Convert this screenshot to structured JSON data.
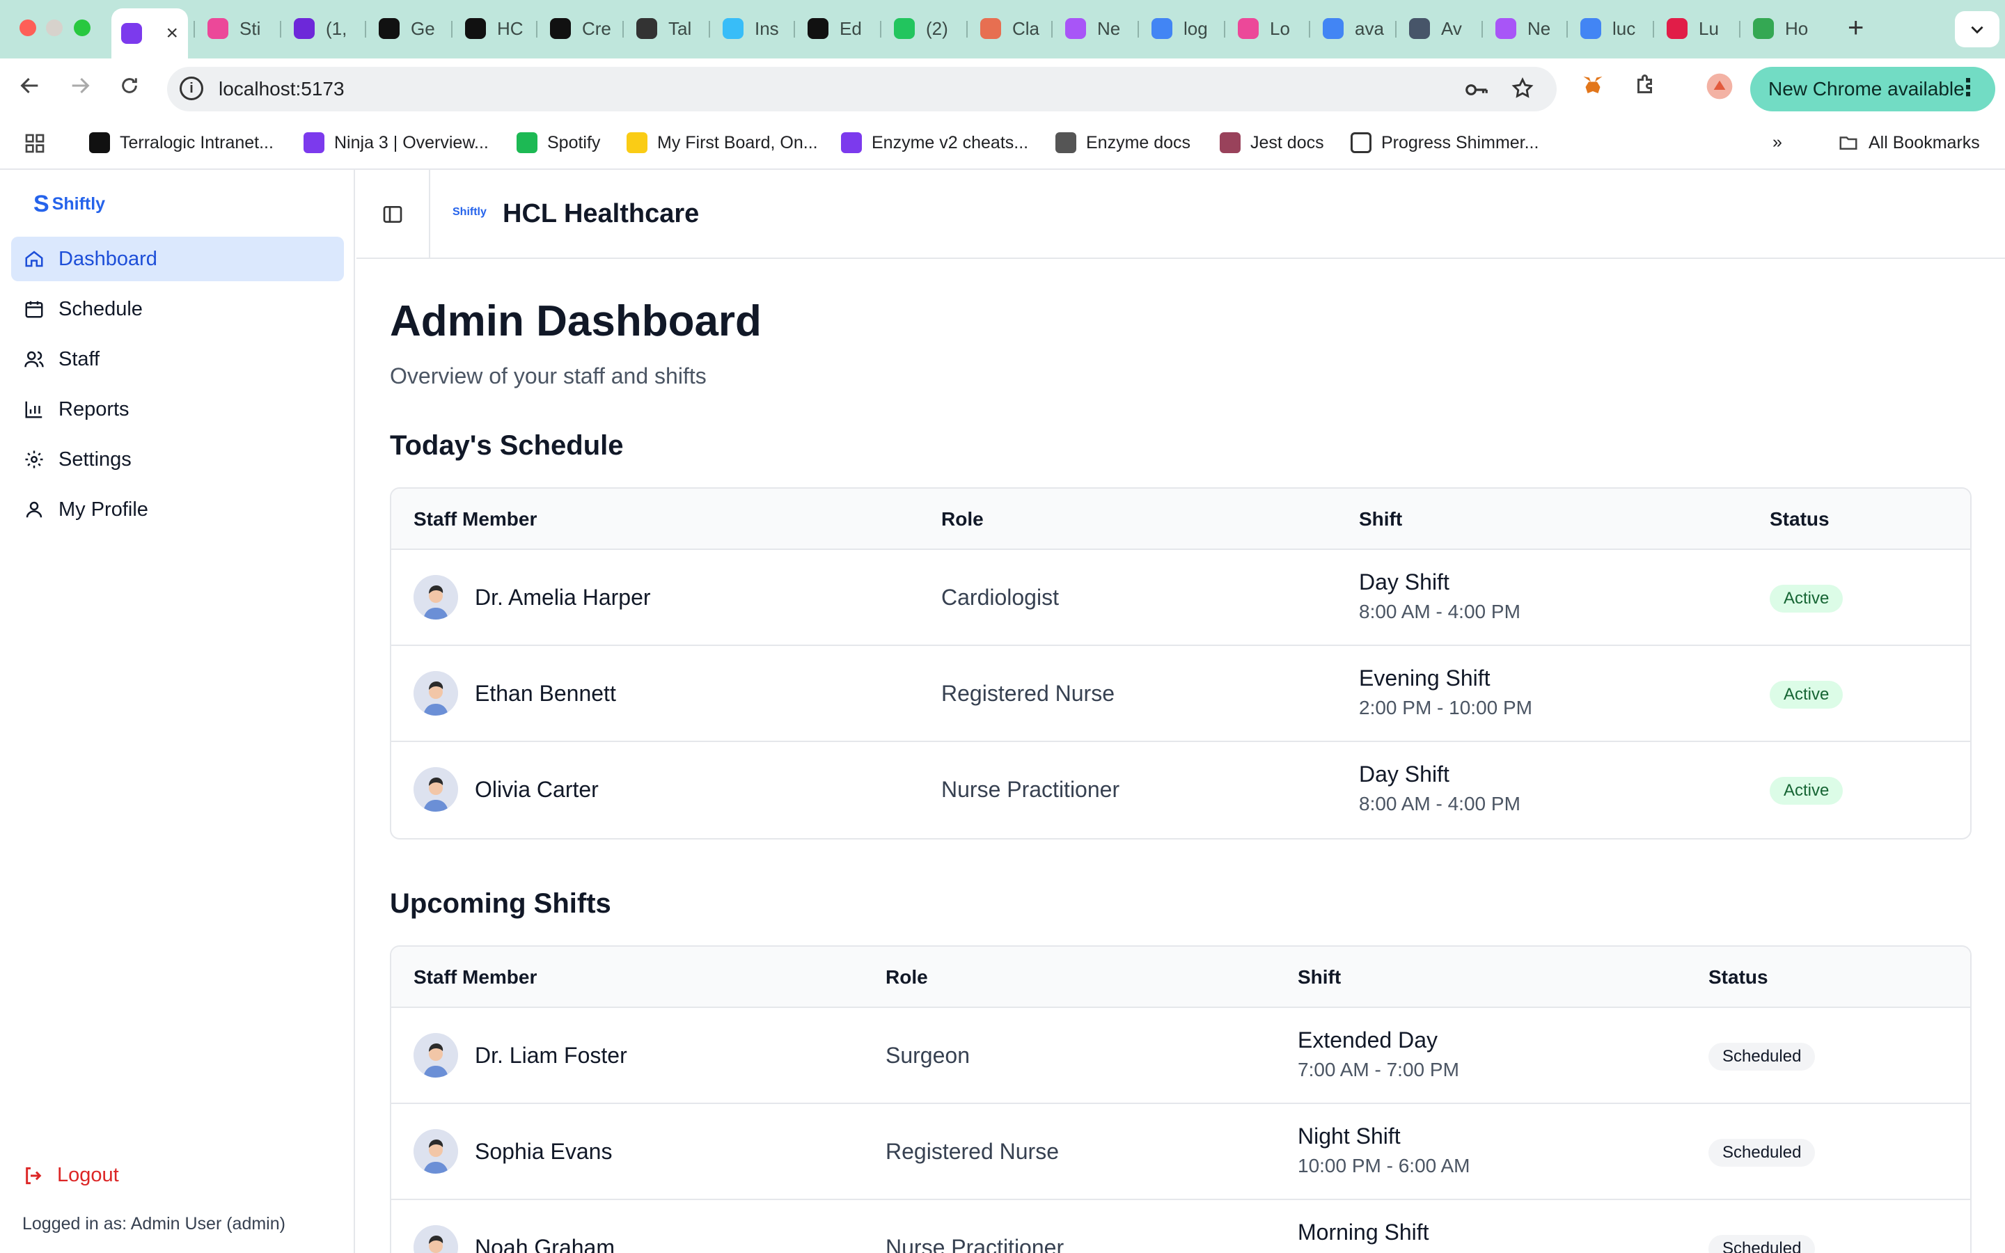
{
  "browser": {
    "tabs": [
      {
        "label": "",
        "fav_color": "#7c3aed",
        "icon": "vite-icon",
        "active": true
      },
      {
        "label": "Sti",
        "fav_color": "#ec4899",
        "icon": "flask-icon"
      },
      {
        "label": "(1,",
        "fav_color": "#6d28d9",
        "icon": "mail-icon"
      },
      {
        "label": "Ge",
        "fav_color": "#111111",
        "icon": "notion-icon"
      },
      {
        "label": "HC",
        "fav_color": "#111111",
        "icon": "openai-icon"
      },
      {
        "label": "Cre",
        "fav_color": "#111111",
        "icon": "triangle-icon"
      },
      {
        "label": "Tal",
        "fav_color": "#333333",
        "icon": "pen-icon"
      },
      {
        "label": "Ins",
        "fav_color": "#38bdf8",
        "icon": "wave-icon"
      },
      {
        "label": "Ed",
        "fav_color": "#111111",
        "icon": "github-icon"
      },
      {
        "label": "(2)",
        "fav_color": "#22c55e",
        "icon": "whatsapp-icon"
      },
      {
        "label": "Cla",
        "fav_color": "#e76f51",
        "icon": "claude-icon"
      },
      {
        "label": "Ne",
        "fav_color": "#a855f7",
        "icon": "heart-icon"
      },
      {
        "label": "log",
        "fav_color": "#4285f4",
        "icon": "google-icon"
      },
      {
        "label": "Lo",
        "fav_color": "#ec4899",
        "icon": "dribbble-icon"
      },
      {
        "label": "ava",
        "fav_color": "#4285f4",
        "icon": "google-icon"
      },
      {
        "label": "Av",
        "fav_color": "#475569",
        "icon": "person-icon"
      },
      {
        "label": "Ne",
        "fav_color": "#a855f7",
        "icon": "heart-icon"
      },
      {
        "label": "luc",
        "fav_color": "#4285f4",
        "icon": "google-icon"
      },
      {
        "label": "Lu",
        "fav_color": "#e11d48",
        "icon": "spiral-icon"
      },
      {
        "label": "Ho",
        "fav_color": "#34a853",
        "icon": "drive-icon"
      }
    ],
    "new_tab_label": "+",
    "url": "localhost:5173",
    "update_label": "New Chrome available",
    "bookmarks": [
      {
        "label": "Terralogic Intranet...",
        "fav_color": "#111111",
        "icon": "globe-icon"
      },
      {
        "label": "Ninja 3 | Overview...",
        "fav_color": "#7c3aed",
        "icon": "ninja-icon"
      },
      {
        "label": "Spotify",
        "fav_color": "#1db954",
        "icon": "spotify-icon"
      },
      {
        "label": "My First Board, On...",
        "fav_color": "#facc15",
        "icon": "miro-icon"
      },
      {
        "label": "Enzyme v2 cheats...",
        "fav_color": "#7c3aed",
        "icon": "doc-icon"
      },
      {
        "label": "Enzyme docs",
        "fav_color": "#555555",
        "icon": "book-icon"
      },
      {
        "label": "Jest docs",
        "fav_color": "#99425b",
        "icon": "jest-icon"
      },
      {
        "label": "Progress Shimmer...",
        "fav_color": "#ffffff",
        "icon": "square-icon"
      }
    ],
    "all_bookmarks_label": "All Bookmarks"
  },
  "sidebar": {
    "brand": "Shiftly",
    "items": [
      {
        "label": "Dashboard",
        "icon": "home-icon",
        "active": true
      },
      {
        "label": "Schedule",
        "icon": "calendar-icon"
      },
      {
        "label": "Staff",
        "icon": "users-icon"
      },
      {
        "label": "Reports",
        "icon": "chart-icon"
      },
      {
        "label": "Settings",
        "icon": "gear-icon"
      },
      {
        "label": "My Profile",
        "icon": "user-icon"
      }
    ],
    "logout_label": "Logout",
    "logged_in_text": "Logged in as: Admin User (admin)"
  },
  "header": {
    "org_logo_text": "Shiftly",
    "org_name": "HCL Healthcare"
  },
  "main": {
    "title": "Admin Dashboard",
    "subtitle": "Overview of your staff and shifts",
    "today": {
      "title": "Today's Schedule",
      "columns": [
        "Staff Member",
        "Role",
        "Shift",
        "Status"
      ],
      "rows": [
        {
          "name": "Dr. Amelia Harper",
          "role": "Cardiologist",
          "shift": "Day Shift",
          "time": "8:00 AM - 4:00 PM",
          "status": "Active"
        },
        {
          "name": "Ethan Bennett",
          "role": "Registered Nurse",
          "shift": "Evening Shift",
          "time": "2:00 PM - 10:00 PM",
          "status": "Active"
        },
        {
          "name": "Olivia Carter",
          "role": "Nurse Practitioner",
          "shift": "Day Shift",
          "time": "8:00 AM - 4:00 PM",
          "status": "Active"
        }
      ]
    },
    "upcoming": {
      "title": "Upcoming Shifts",
      "columns": [
        "Staff Member",
        "Role",
        "Shift",
        "Status"
      ],
      "rows": [
        {
          "name": "Dr. Liam Foster",
          "role": "Surgeon",
          "shift": "Extended Day",
          "time": "7:00 AM - 7:00 PM",
          "status": "Scheduled"
        },
        {
          "name": "Sophia Evans",
          "role": "Registered Nurse",
          "shift": "Night Shift",
          "time": "10:00 PM - 6:00 AM",
          "status": "Scheduled"
        },
        {
          "name": "Noah Graham",
          "role": "Nurse Practitioner",
          "shift": "Morning Shift",
          "time": "",
          "status": "Scheduled"
        }
      ]
    }
  },
  "colors": {
    "accent": "#2563eb",
    "active_nav_bg": "#dbe8fd",
    "active_badge_bg": "#dcfce7",
    "logout": "#dc2626"
  }
}
